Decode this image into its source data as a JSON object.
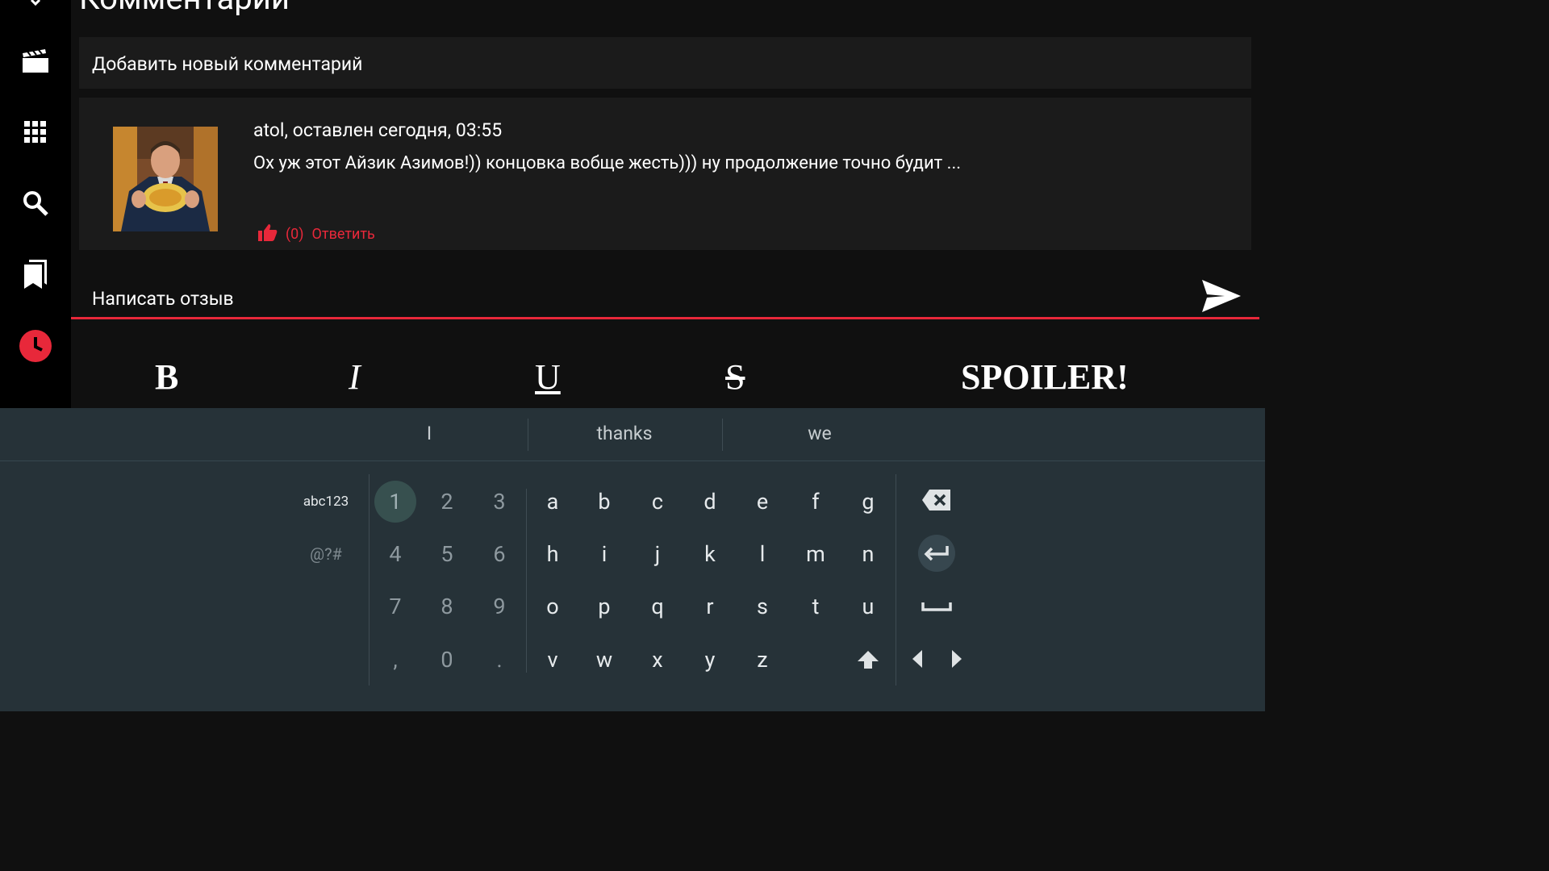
{
  "header": {
    "title": "Комментарии"
  },
  "add_comment": {
    "label": "Добавить новый комментарий"
  },
  "comment": {
    "author_line": "atol, оставлен сегодня, 03:55",
    "text": "Ох уж этот Айзик Азимов!)) концовка вобще жесть))) ну продолжение точно будит ...",
    "likes": "(0)",
    "reply_label": "Ответить"
  },
  "review": {
    "placeholder": "Написать отзыв"
  },
  "format_toolbar": {
    "bold": "B",
    "italic": "I",
    "underline": "U",
    "strike": "S",
    "spoiler": "SPOILER!"
  },
  "keyboard": {
    "suggestions": [
      "I",
      "thanks",
      "we"
    ],
    "modes": {
      "alpha_num": "abc123",
      "symbols": "@?#"
    },
    "digits": [
      [
        "1",
        "2",
        "3"
      ],
      [
        "4",
        "5",
        "6"
      ],
      [
        "7",
        "8",
        "9"
      ],
      [
        ",",
        "0",
        "."
      ]
    ],
    "letters": [
      [
        "a",
        "b",
        "c",
        "d",
        "e",
        "f",
        "g"
      ],
      [
        "h",
        "i",
        "j",
        "k",
        "l",
        "m",
        "n"
      ],
      [
        "o",
        "p",
        "q",
        "r",
        "s",
        "t",
        "u"
      ],
      [
        "v",
        "w",
        "x",
        "y",
        "z"
      ]
    ],
    "selected_key": "1"
  },
  "colors": {
    "accent": "#e8283a",
    "keyboard_bg": "#263238",
    "card_bg": "#1b1b1b",
    "sidebar_bg": "#000000"
  },
  "icons": [
    "film-icon",
    "grid-icon",
    "search-icon",
    "bookmarks-icon",
    "history-icon",
    "send-icon",
    "thumb-up-icon",
    "backspace-icon",
    "enter-icon",
    "space-icon",
    "shift-icon",
    "arrow-left-icon",
    "arrow-right-icon"
  ]
}
